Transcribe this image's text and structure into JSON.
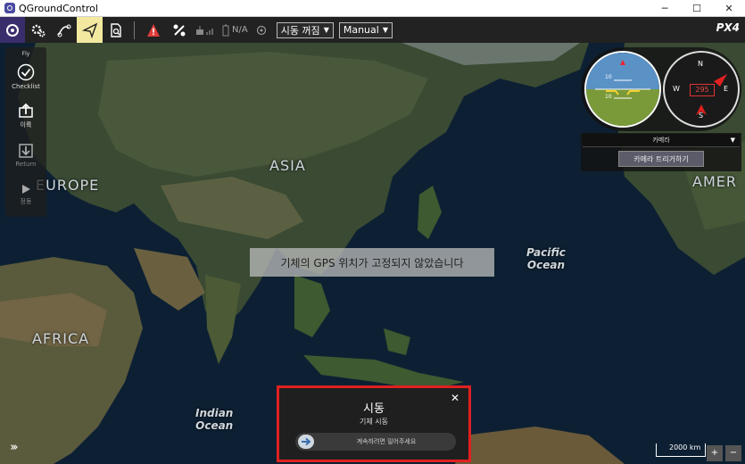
{
  "window": {
    "title": "QGroundControl",
    "controls": [
      "─",
      "☐",
      "✕"
    ]
  },
  "toolbar": {
    "gps_value": "N/A",
    "flight_mode": "시동 꺼짐",
    "control_mode": "Manual",
    "brand": "PX4"
  },
  "toolstrip": {
    "header": "Fly",
    "items": [
      {
        "label": "Checklist",
        "icon": "checklist-icon"
      },
      {
        "label": "이륙",
        "icon": "takeoff-icon"
      },
      {
        "label": "Return",
        "icon": "return-icon"
      },
      {
        "label": "정동",
        "icon": "play-icon"
      }
    ]
  },
  "map": {
    "labels": {
      "asia": "ASIA",
      "europe": "EUROPE",
      "africa": "AFRICA",
      "america": "AMER",
      "pacific": "Pacific\nOcean",
      "indian": "Indian\nOcean"
    }
  },
  "instruments": {
    "heading": "295",
    "compass": {
      "n": "N",
      "e": "E",
      "s": "S",
      "w": "W"
    },
    "pitch_top": "10",
    "pitch_bottom": "10"
  },
  "camera": {
    "selector": "카메라",
    "trigger": "카메라 트리거하기"
  },
  "toast": {
    "message": "기체의 GPS 위치가 고정되지 않았습니다"
  },
  "arm_dialog": {
    "title": "시동",
    "subtitle": "기체 시동",
    "slider_text": "계속하려면 밀어주세요",
    "close": "✕"
  },
  "map_controls": {
    "scale": "2000 km",
    "zoom_in": "+",
    "zoom_out": "−"
  }
}
